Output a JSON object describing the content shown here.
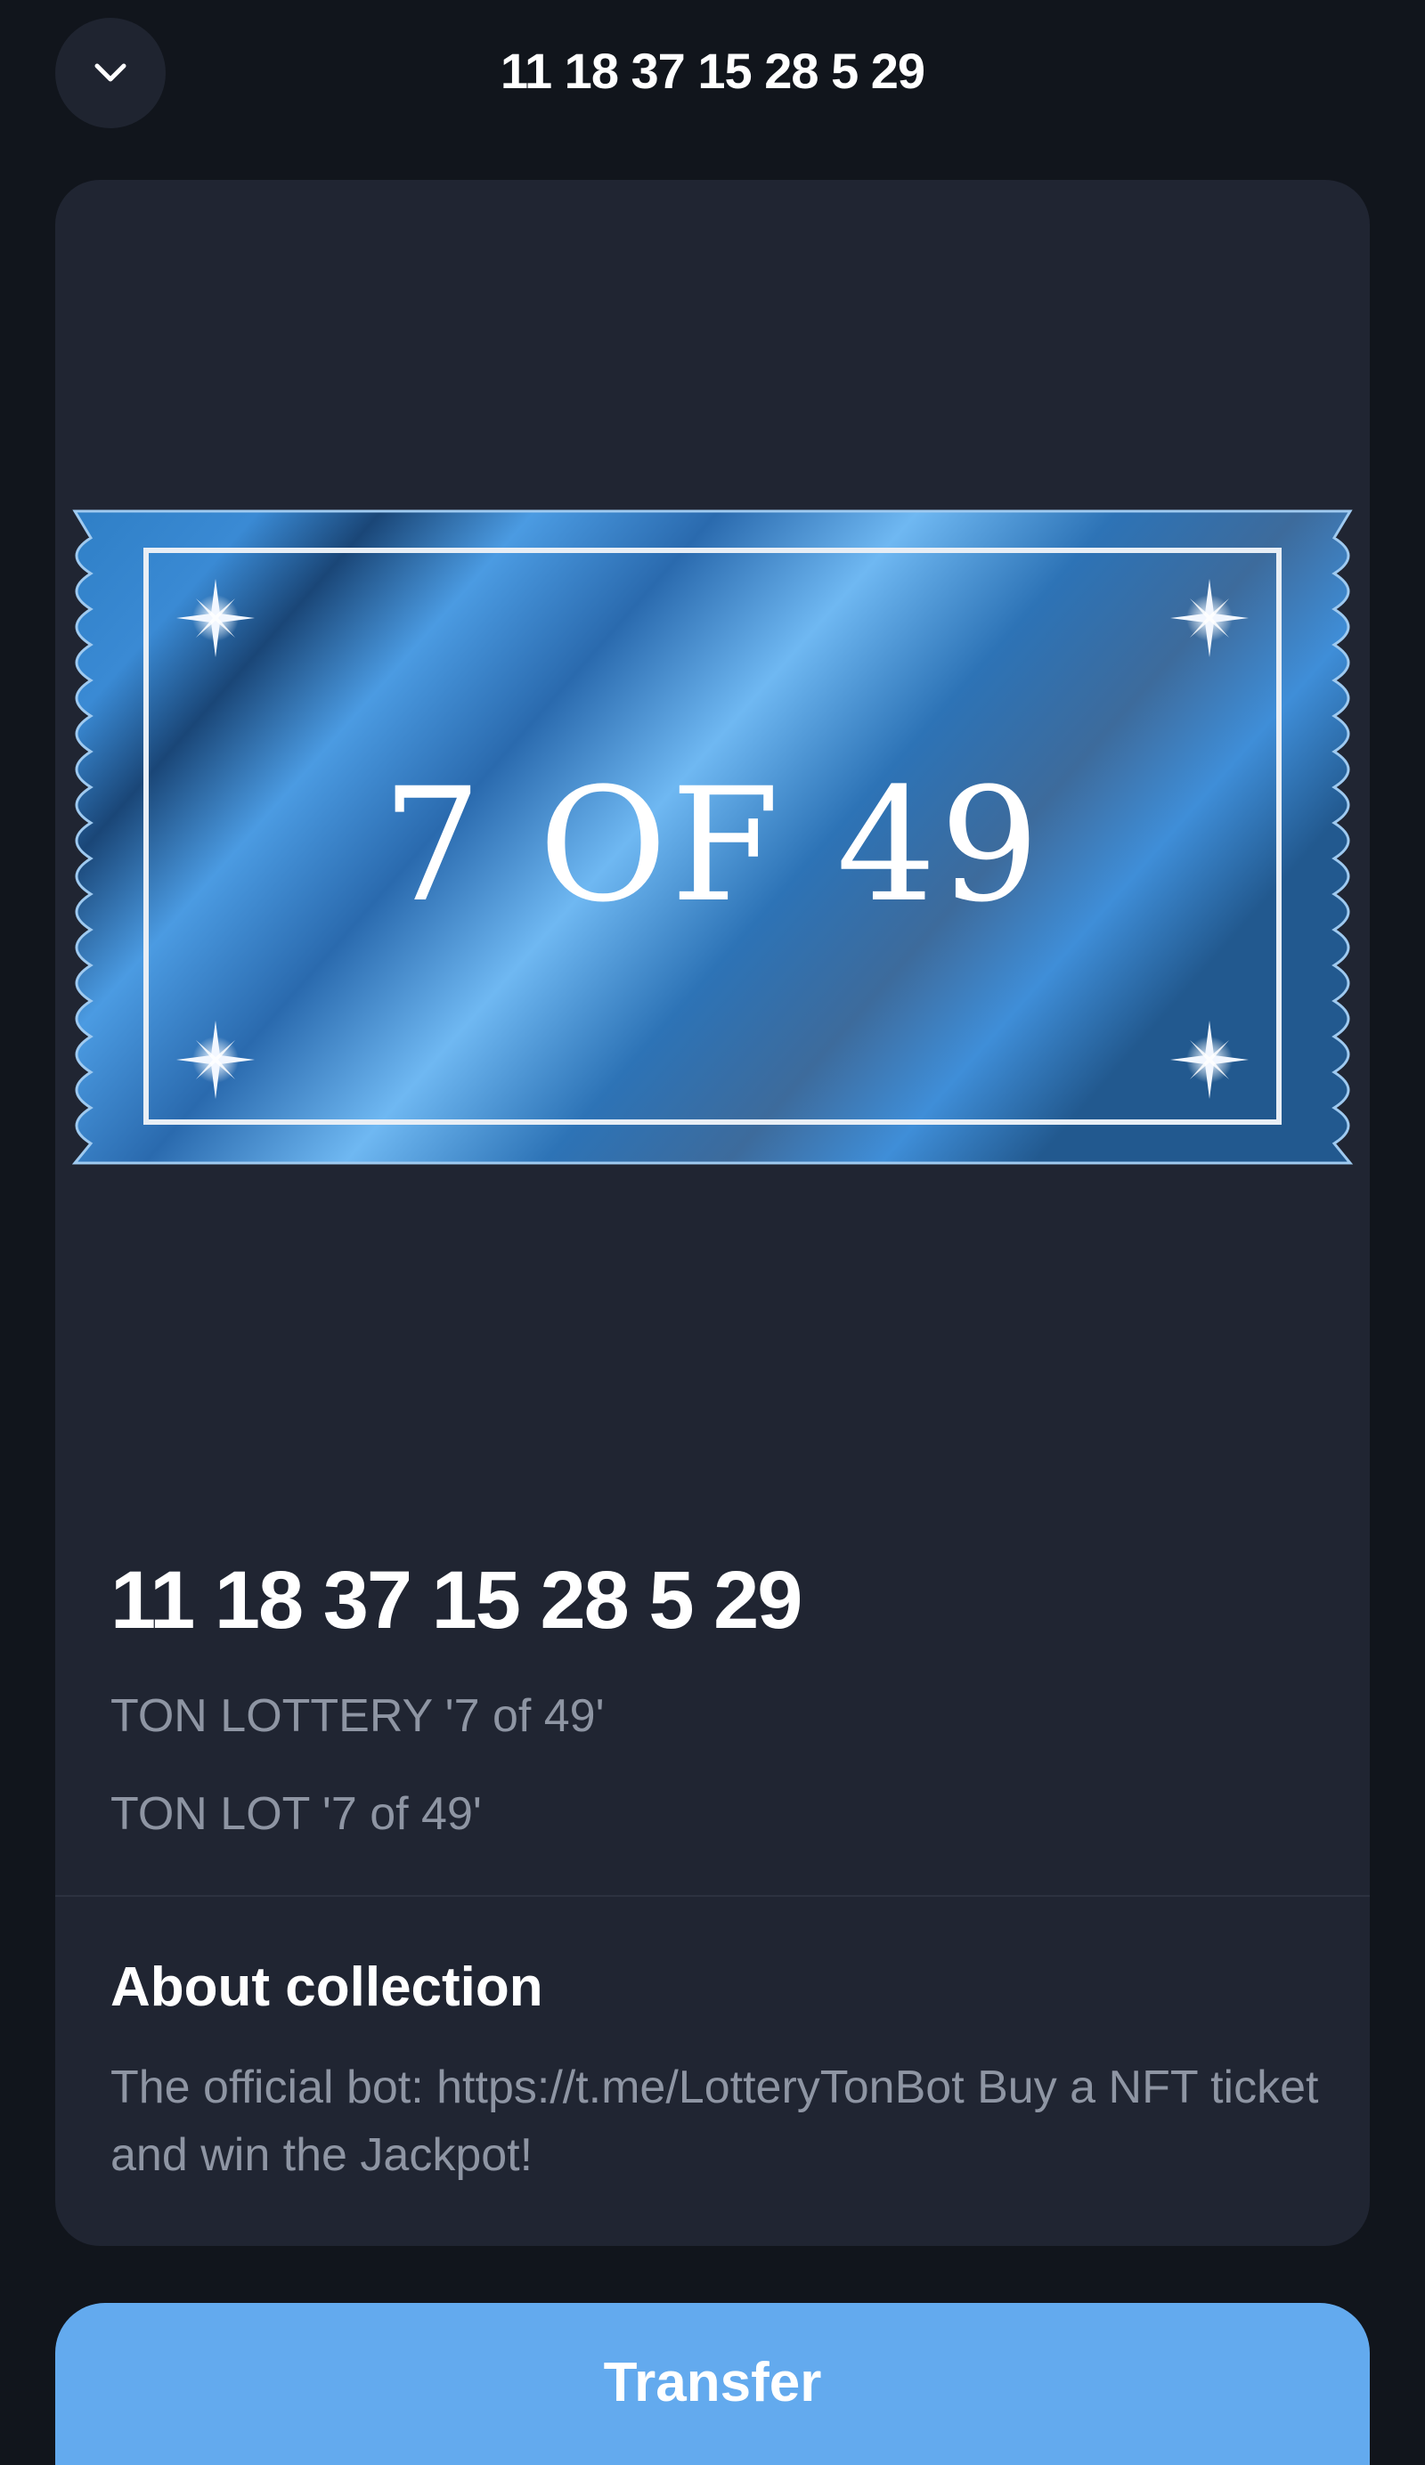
{
  "header": {
    "title": "11 18 37 15 28 5 29",
    "collapse_icon": "chevron-down-icon"
  },
  "ticket": {
    "text": "7 OF 49",
    "decor_icon": "sparkle-icon",
    "colors": {
      "dark": "#1a4677",
      "mid": "#3a86cf",
      "light": "#6fb8f2"
    }
  },
  "nft": {
    "name": "11 18 37 15 28 5 29",
    "collection": "TON LOTTERY '7 of 49'",
    "collection_short": "TON LOT '7 of 49'"
  },
  "about": {
    "title": "About collection",
    "text": "The official bot: https://t.me/LotteryTonBot Buy a NFT ticket and win the Jackpot!"
  },
  "actions": {
    "transfer_label": "Transfer"
  },
  "colors": {
    "background": "#11151c",
    "card": "#202532",
    "muted_text": "#8e95a3",
    "accent": "#63aaee"
  }
}
